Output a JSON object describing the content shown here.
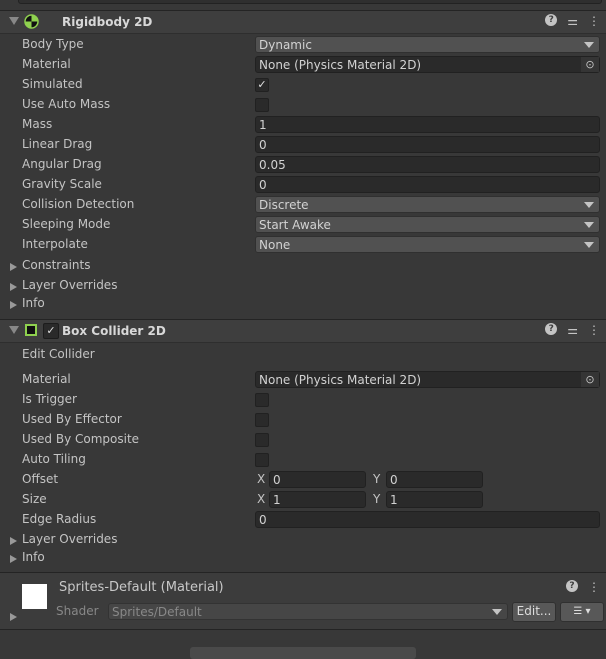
{
  "rigidbody": {
    "title": "Rigidbody 2D",
    "rows": [
      {
        "label": "Body Type",
        "value": "Dynamic",
        "kind": "dropdown"
      },
      {
        "label": "Material",
        "value": "None (Physics Material 2D)",
        "kind": "object"
      },
      {
        "label": "Simulated",
        "checked": true,
        "kind": "checkbox"
      },
      {
        "label": "Use Auto Mass",
        "checked": false,
        "kind": "checkbox"
      },
      {
        "label": "Mass",
        "value": "1",
        "kind": "text"
      },
      {
        "label": "Linear Drag",
        "value": "0",
        "kind": "text"
      },
      {
        "label": "Angular Drag",
        "value": "0.05",
        "kind": "text"
      },
      {
        "label": "Gravity Scale",
        "value": "0",
        "kind": "text"
      },
      {
        "label": "Collision Detection",
        "value": "Discrete",
        "kind": "dropdown"
      },
      {
        "label": "Sleeping Mode",
        "value": "Start Awake",
        "kind": "dropdown"
      },
      {
        "label": "Interpolate",
        "value": "None",
        "kind": "dropdown"
      }
    ],
    "foldouts": [
      "Constraints",
      "Layer Overrides",
      "Info"
    ]
  },
  "boxcollider": {
    "title": "Box Collider 2D",
    "enabled": true,
    "edit_collider": "Edit Collider",
    "rows": [
      {
        "label": "Material",
        "value": "None (Physics Material 2D)",
        "kind": "object"
      },
      {
        "label": "Is Trigger",
        "checked": false,
        "kind": "checkbox"
      },
      {
        "label": "Used By Effector",
        "checked": false,
        "kind": "checkbox"
      },
      {
        "label": "Used By Composite",
        "checked": false,
        "kind": "checkbox"
      },
      {
        "label": "Auto Tiling",
        "checked": false,
        "kind": "checkbox"
      }
    ],
    "offset": {
      "label": "Offset",
      "x_label": "X",
      "x": "0",
      "y_label": "Y",
      "y": "0"
    },
    "size": {
      "label": "Size",
      "x_label": "X",
      "x": "1",
      "y_label": "Y",
      "y": "1"
    },
    "edge_radius": {
      "label": "Edge Radius",
      "value": "0"
    },
    "foldouts": [
      "Layer Overrides",
      "Info"
    ]
  },
  "material": {
    "title": "Sprites-Default (Material)",
    "shader_label": "Shader",
    "shader": "Sprites/Default",
    "edit": "Edit..."
  },
  "colors": {
    "accent": "#8fd14f",
    "bg": "#383838",
    "field": "#2a2a2a"
  }
}
